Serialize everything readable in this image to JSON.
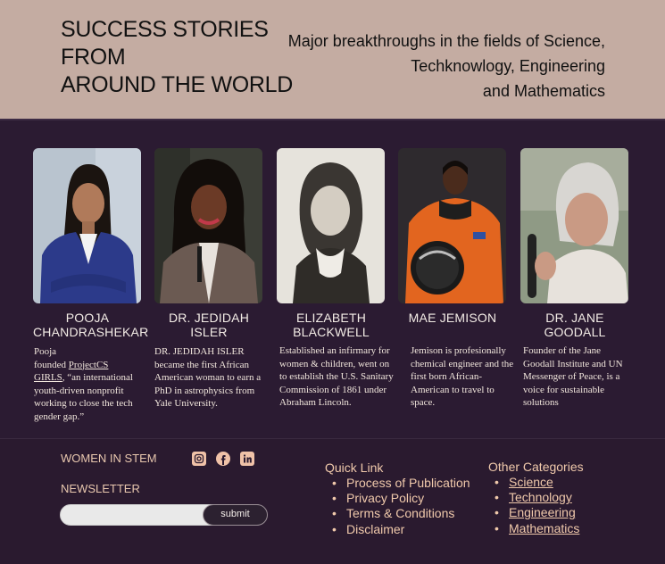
{
  "header": {
    "title_lines": [
      "SUCCESS STORIES",
      "FROM",
      "AROUND THE WORLD"
    ],
    "subtitle_lines": [
      "Major breakthroughs in the fields of Science,",
      "Techknowlogy, Engineering",
      "and Mathematics"
    ]
  },
  "profiles": [
    {
      "name": "POOJA\nCHANDRASHEKAR",
      "desc_before": "Pooja\nfounded ",
      "desc_link": "ProjectCS GIRLS",
      "desc_after": ", “an international youth-driven  nonprofit working to close the tech gender gap.”"
    },
    {
      "name": "DR. JEDIDAH ISLER",
      "desc": "DR. JEDIDAH ISLER became the first African American woman to earn a PhD in astrophysics from Yale University."
    },
    {
      "name": "ELIZABETH\nBLACKWELL",
      "desc": "Established an infirmary for women & children, went on to establish the U.S. Sanitary Commission of 1861 under Abraham Lincoln."
    },
    {
      "name": "MAE JEMISON",
      "desc": "Jemison is profesionally chemical engineer and the first born African-American to travel to space."
    },
    {
      "name": "DR. JANE GOODALL",
      "desc": "Founder of the Jane Goodall Institute and  UN Messenger of Peace, is a voice for sustainable  solutions"
    }
  ],
  "footer": {
    "brand": "WOMEN IN STEM",
    "newsletter_label": "NEWSLETTER",
    "newsletter_placeholder": "",
    "submit_label": "submit",
    "social_icons": [
      "instagram-icon",
      "facebook-icon",
      "linkedin-icon"
    ],
    "quick_link_title": "Quick Link",
    "quick_links": [
      "Process of Publication",
      "Privacy Policy",
      "Terms & Conditions",
      "Disclaimer"
    ],
    "other_title": "Other Categories",
    "other_categories": [
      "Science",
      "Technology",
      "Engineering",
      "Mathematics"
    ],
    "bullet": "•"
  },
  "colors": {
    "header_bg": "#c4aca2",
    "body_bg": "#2b1b32",
    "accent_peach": "#f0c9ab"
  }
}
